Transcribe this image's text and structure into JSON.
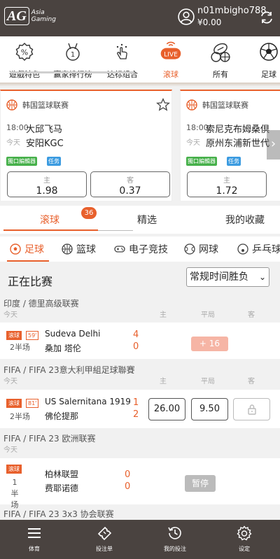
{
  "header": {
    "logo_mark": "AG",
    "logo_line1": "Asia",
    "logo_line2": "Gaming",
    "username": "n01mbigho788",
    "balance": "¥0.00"
  },
  "categories": [
    {
      "label": "遊戲特色"
    },
    {
      "label": "赢家排行榜"
    },
    {
      "label": "达标组合"
    },
    {
      "label": "滚球",
      "icon_text": "LIVE",
      "active": true
    },
    {
      "label": "所有"
    },
    {
      "label": "足球"
    }
  ],
  "featured": [
    {
      "league": "韩国篮球联赛",
      "time": "18:00",
      "day": "今天",
      "team1": "大邱飞马",
      "team2": "安阳KGC",
      "tag1": "獨口編輯器",
      "tag2": "任务",
      "home_label": "主",
      "home_odds": "1.98",
      "away_label": "客",
      "away_odds": "0.37"
    },
    {
      "league": "韩国篮球联赛",
      "time": "18:00",
      "day": "今天",
      "team1": "索尼克布姆桑倶",
      "team2": "原州东浦新世代",
      "tag1": "獨口編輯器",
      "tag2": "任务",
      "home_label": "主",
      "home_odds": "1.72"
    }
  ],
  "main_tabs": [
    {
      "label": "滚球",
      "badge": "36",
      "active": true
    },
    {
      "label": "精选"
    },
    {
      "label": "我的收藏"
    }
  ],
  "sport_tabs": [
    {
      "label": "足球",
      "active": true
    },
    {
      "label": "篮球"
    },
    {
      "label": "电子竞技"
    },
    {
      "label": "网球"
    },
    {
      "label": "乒乓球"
    }
  ],
  "section": {
    "title": "正在比赛",
    "market_select": "常规时间胜负",
    "chevron": "⌄"
  },
  "col_labels": {
    "home": "主",
    "draw": "平局",
    "away": "客"
  },
  "leagues": [
    {
      "name": "印度 / 德里高级联赛",
      "day": "今天",
      "match": {
        "live": "滚球",
        "minute": "59'",
        "period": "2半场",
        "team1": "Sudeva Delhi",
        "team2": "桑加 塔伦",
        "score1": "4",
        "score2": "0",
        "more": "+ 16"
      }
    },
    {
      "name": "FIFA / FIFA 23意大利甲組足球聯賽",
      "day": "今天",
      "match": {
        "live": "滚球",
        "minute": "81'",
        "period": "2半场",
        "team1": "US Salernitana 1919",
        "team2": "佛伦提那",
        "score1": "1",
        "score2": "2",
        "odds_home": "26.00",
        "odds_draw": "9.50"
      }
    },
    {
      "name": "FIFA / FIFA 23 欧洲联赛",
      "day": "今天",
      "match": {
        "live": "滚球",
        "period_line1": "1",
        "period_line2": "半",
        "period_line3": "场",
        "team1": "柏林联盟",
        "team2": "费耶诺德",
        "score1": "0",
        "score2": "0",
        "status": "暂停"
      }
    },
    {
      "name": "FIFA / FIFA 23 3x3 协会联赛"
    }
  ],
  "bottom_nav": [
    {
      "label": "体育"
    },
    {
      "label": "投注单"
    },
    {
      "label": "我的投注"
    },
    {
      "label": "设定"
    }
  ],
  "colors": {
    "accent": "#e8602c",
    "header_bg": "#4a4340",
    "tag_green": "#46b04a",
    "tag_blue": "#3b9be0"
  }
}
